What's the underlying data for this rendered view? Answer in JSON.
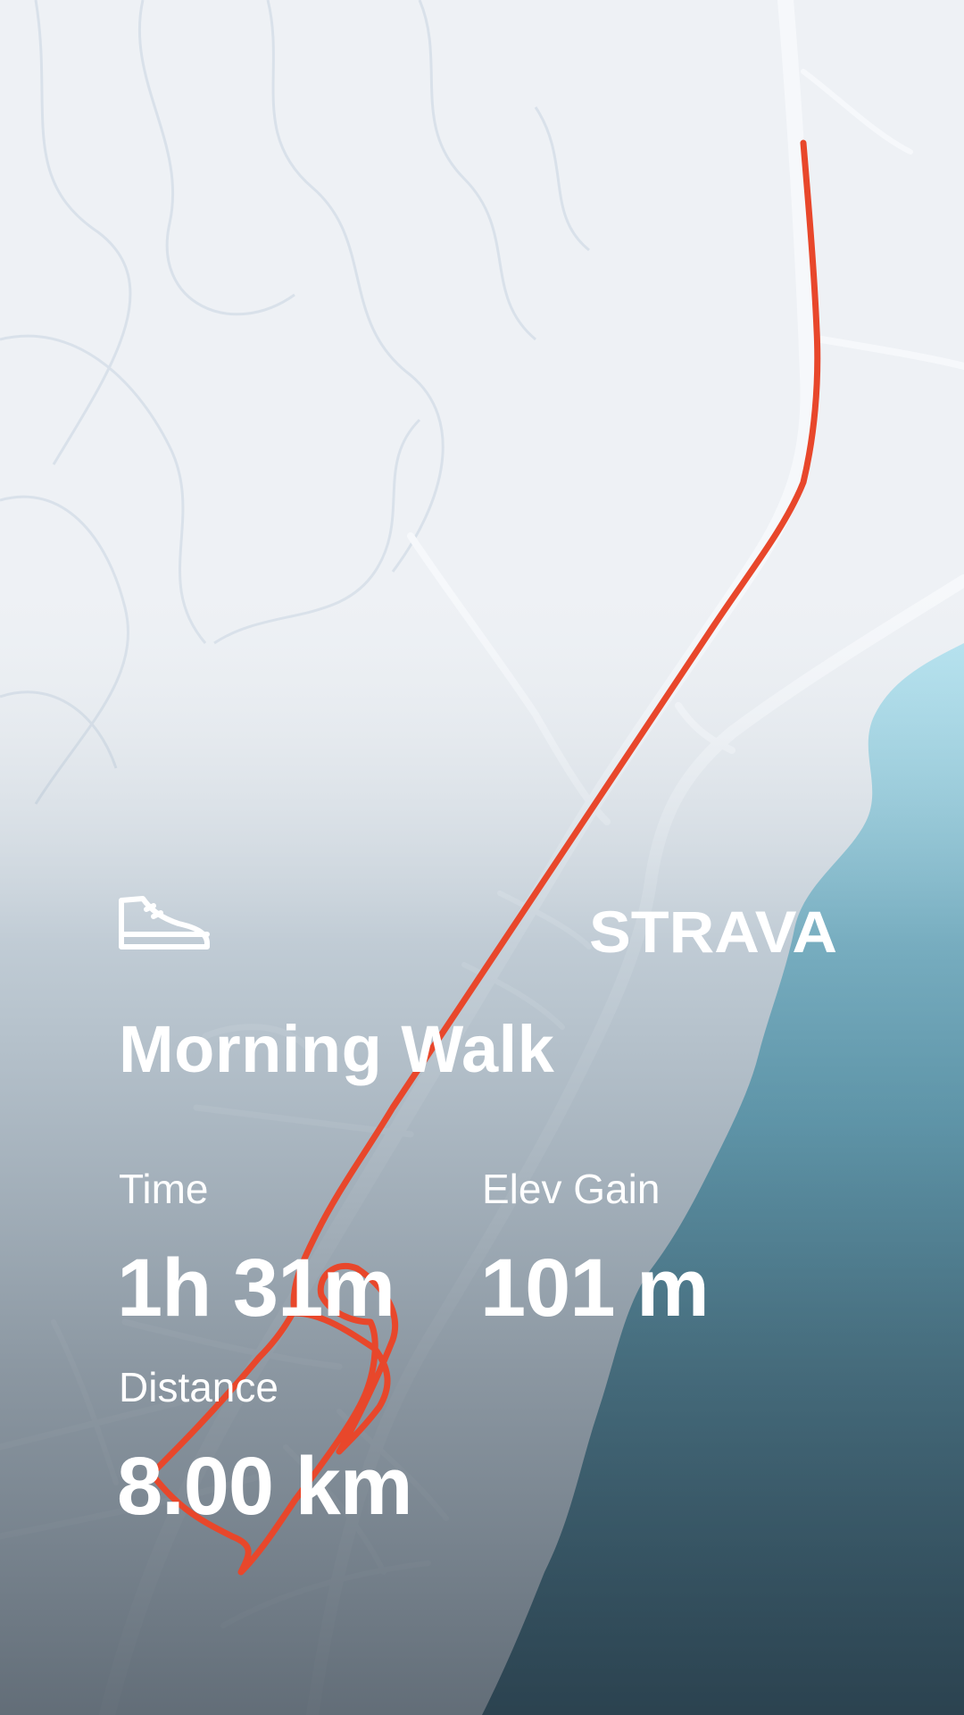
{
  "activity": {
    "type_icon": "shoe-icon",
    "title": "Morning Walk"
  },
  "brand": {
    "logo_text": "STRAVA"
  },
  "stats": {
    "time_label": "Time",
    "time_value": "1h 31m",
    "elev_label": "Elev Gain",
    "elev_value": "101 m",
    "distance_label": "Distance",
    "distance_value": "8.00 km"
  },
  "colors": {
    "route": "#e8472b",
    "water_top": "#a8dbe9",
    "water_bottom": "#2b5d6d",
    "land": "#eef1f5",
    "text": "#ffffff"
  }
}
